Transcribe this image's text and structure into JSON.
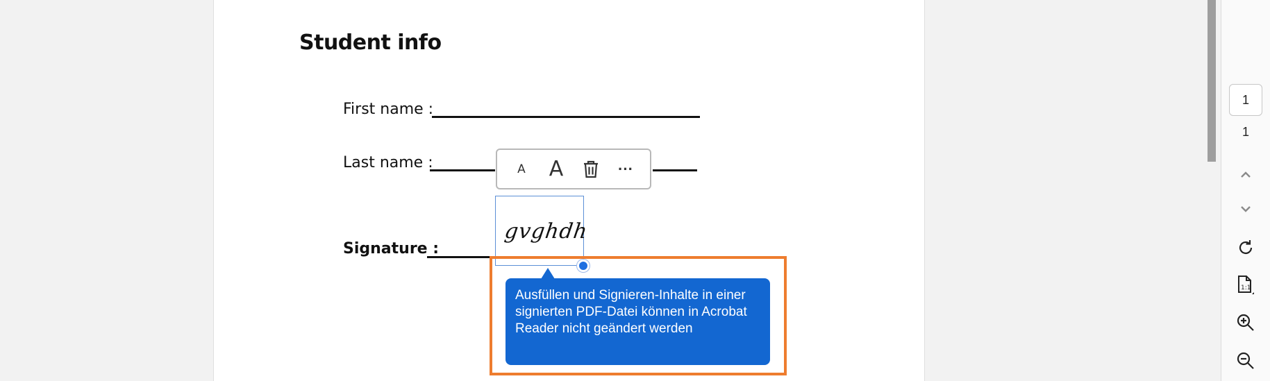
{
  "document": {
    "heading": "Student info",
    "fields": {
      "first_name_label": "First name :",
      "last_name_label": "Last name :",
      "signature_label": "Signature :"
    },
    "signature_text": "gvghdh"
  },
  "toolbar": {
    "decrease_text_label": "A",
    "increase_text_label": "A",
    "delete_icon": "trash-icon",
    "more_label": "···"
  },
  "tooltip": {
    "message": "Ausfüllen und Signieren-Inhalte in einer signierten PDF-Datei können in Acrobat Reader nicht geändert werden",
    "background_color": "#1367d1",
    "highlight_color": "#ee7d2f"
  },
  "navigation": {
    "current_page": "1",
    "total_pages": "1",
    "icons": [
      "chevron-up-icon",
      "chevron-down-icon",
      "rotate-icon",
      "actual-size-icon",
      "zoom-in-icon",
      "zoom-out-icon"
    ]
  }
}
